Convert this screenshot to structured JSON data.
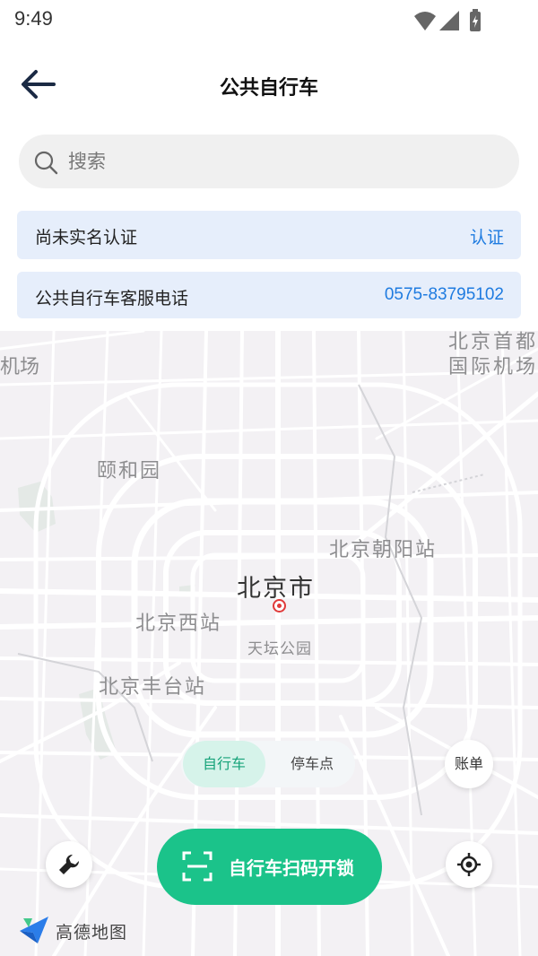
{
  "status_bar": {
    "time": "9:49"
  },
  "header": {
    "title": "公共自行车"
  },
  "search": {
    "placeholder": "搜索"
  },
  "verify_bar": {
    "label": "尚未实名认证",
    "action": "认证"
  },
  "phone_bar": {
    "label": "公共自行车客服电话",
    "phone": "0575-83795102"
  },
  "map": {
    "labels": {
      "airport_line1": "北京首都",
      "airport_line2": "国际机场",
      "airport_fragment": "机场",
      "yiheyuan": "颐和园",
      "chaoyang_station": "北京朝阳站",
      "city": "北京市",
      "west_station": "北京西站",
      "tiantan": "天坛公园",
      "fengtai_station": "北京丰台站"
    }
  },
  "controls": {
    "segment_bike": "自行车",
    "segment_parking": "停车点",
    "bill": "账单",
    "scan_unlock": "自行车扫码开锁"
  },
  "branding": {
    "map_provider": "高德地图"
  },
  "colors": {
    "accent_green": "#1bc38a",
    "link_blue": "#1e7be0",
    "info_bar_bg": "#e6eefb",
    "city_marker": "#e03a3a"
  },
  "icons": [
    "back-arrow-icon",
    "search-icon",
    "wifi-icon",
    "signal-icon",
    "battery-icon",
    "wrench-icon",
    "locate-icon",
    "scan-frame-icon",
    "amap-logo-icon"
  ]
}
